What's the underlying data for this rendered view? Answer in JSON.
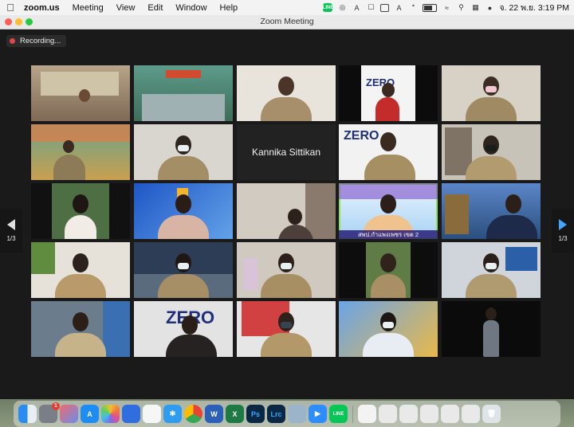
{
  "menubar": {
    "apple_icon": "apple-icon",
    "items": [
      "zoom.us",
      "Meeting",
      "View",
      "Edit",
      "Window",
      "Help"
    ],
    "clock": "จ. 22 พ.ย.  3:19 PM",
    "battery_level": 0.6
  },
  "window": {
    "title": "Zoom Meeting"
  },
  "recording": {
    "label": "Recording..."
  },
  "participants": {
    "name_tile": "Kannika Sittikan",
    "active_caption": "สพป.กำแพงเพชร เขต 2",
    "zero_logo_text": "ZERO"
  },
  "pagination": {
    "left": "1/3",
    "right": "1/3"
  },
  "dock": {
    "apps": [
      "finder-icon",
      "system-preferences-icon",
      "launchpad-icon",
      "app-store-icon",
      "photos-icon",
      "keynote-icon",
      "reminders-icon",
      "safari-icon",
      "chrome-icon",
      "word-icon",
      "excel-icon",
      "photoshop-icon",
      "lightroom-classic-icon",
      "preview-icon",
      "zoom-icon",
      "line-icon"
    ],
    "labels": {
      "word": "W",
      "excel": "X",
      "photoshop": "Ps",
      "lightroom": "Lrc",
      "line": "LINE"
    },
    "badge": "1"
  },
  "colors": {
    "active_speaker": "#8fe34c",
    "nav_arrow": "#3fa8ff",
    "recording_dot": "#e04848"
  }
}
